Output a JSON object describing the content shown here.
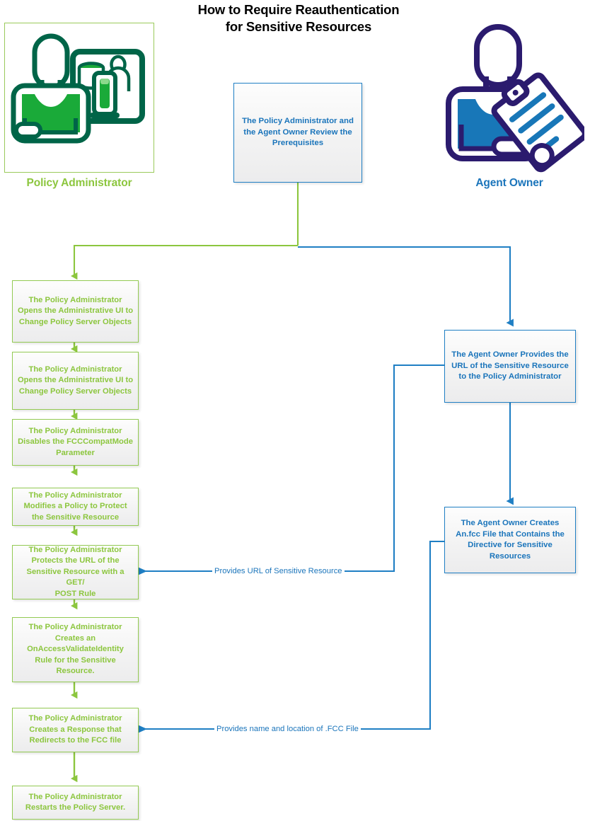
{
  "title": {
    "line1": "How to Require Reauthentication",
    "line2": "for Sensitive Resources"
  },
  "colors": {
    "green_light": "#8CC63E",
    "green_border": "#93CA53",
    "green_dark": "#006548",
    "green_fill": "#1AAA39",
    "blue": "#1B75BB",
    "blue_border": "#1F7FC4",
    "navy": "#2B1B6E",
    "blue_fill": "#1877B8",
    "box_fill": "#F1F1F1"
  },
  "actors": [
    {
      "id": "policy-administrator",
      "label": "Policy Administrator",
      "icon": "admin-with-monitor-icon"
    },
    {
      "id": "agent-owner",
      "label": "Agent Owner",
      "icon": "person-with-clipboard-icon"
    }
  ],
  "nodes": {
    "start": {
      "id": "review-prerequisites",
      "text": "The Policy Administrator and\nthe Agent Owner Review the\nPrerequisites"
    },
    "green": [
      {
        "id": "open-admin-ui-1",
        "text": "The Policy Administrator\nOpens the Administrative UI to\nChange Policy Server Objects"
      },
      {
        "id": "open-admin-ui-2",
        "text": "The Policy Administrator\nOpens the Administrative UI to\nChange Policy Server Objects"
      },
      {
        "id": "disable-fcccompatmode",
        "text": "The Policy Administrator\nDisables the FCCCompatMode\nParameter"
      },
      {
        "id": "modify-policy",
        "text": "The Policy Administrator\nModifies a Policy to Protect\nthe Sensitive Resource"
      },
      {
        "id": "protect-url-rule",
        "text": "The Policy Administrator\nProtects the URL of the\nSensitive Resource with a GET/\nPOST Rule"
      },
      {
        "id": "create-onaccessvalidateidentity-rule",
        "text": "The Policy Administrator\nCreates an\nOnAccessValidateIdentity\nRule for the Sensitive\nResource."
      },
      {
        "id": "create-response-redirect",
        "text": "The Policy Administrator\nCreates a Response that\nRedirects to the FCC file"
      },
      {
        "id": "restart-policy-server",
        "text": "The Policy Administrator\nRestarts the Policy Server."
      }
    ],
    "blue": [
      {
        "id": "agent-owner-provides-url",
        "text": "The Agent Owner Provides the\nURL of the Sensitive Resource\nto the Policy Administrator"
      },
      {
        "id": "agent-owner-creates-fcc",
        "text": "The Agent Owner Creates\nAn.fcc File that Contains the\nDirective for Sensitive\nResources"
      }
    ]
  },
  "connector_labels": [
    {
      "id": "provides-url-label",
      "text": "Provides URL of Sensitive Resource"
    },
    {
      "id": "provides-fcc-label",
      "text": "Provides name and location of .FCC File"
    }
  ]
}
